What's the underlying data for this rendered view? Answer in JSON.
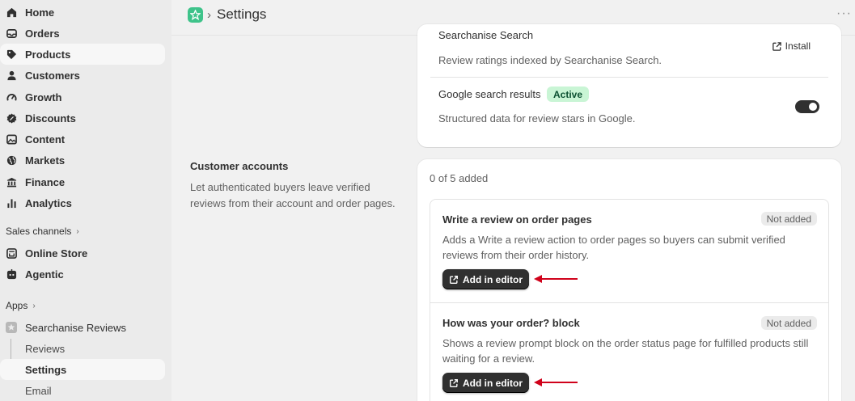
{
  "sidebar": {
    "items": [
      {
        "label": "Home",
        "icon": "home-icon"
      },
      {
        "label": "Orders",
        "icon": "inbox-icon"
      },
      {
        "label": "Products",
        "icon": "tag-icon"
      },
      {
        "label": "Customers",
        "icon": "person-icon"
      },
      {
        "label": "Growth",
        "icon": "gauge-icon"
      },
      {
        "label": "Discounts",
        "icon": "discount-icon"
      },
      {
        "label": "Content",
        "icon": "image-icon"
      },
      {
        "label": "Markets",
        "icon": "globe-icon"
      },
      {
        "label": "Finance",
        "icon": "bank-icon"
      },
      {
        "label": "Analytics",
        "icon": "bar-chart-icon"
      }
    ],
    "sales_channels_heading": "Sales channels",
    "sales_channels": [
      {
        "label": "Online Store",
        "icon": "store-icon"
      },
      {
        "label": "Agentic",
        "icon": "agentic-icon"
      }
    ],
    "apps_heading": "Apps",
    "apps": [
      {
        "label": "Searchanise Reviews",
        "icon": "app-icon"
      }
    ],
    "app_subitems": [
      "Reviews",
      "Settings",
      "Email"
    ]
  },
  "header": {
    "title": "Settings",
    "more": "···"
  },
  "integrations": {
    "searchanise": {
      "title": "Searchanise Search",
      "description": "Review ratings indexed by Searchanise Search.",
      "action": "Install"
    },
    "google": {
      "title": "Google search results",
      "badge": "Active",
      "description": "Structured data for review stars in Google.",
      "toggle_on": true
    }
  },
  "customer_accounts": {
    "title": "Customer accounts",
    "description": "Let authenticated buyers leave verified reviews from their account and order pages.",
    "count": "0 of 5 added",
    "items": [
      {
        "title": "Write a review on order pages",
        "badge": "Not added",
        "description": "Adds a Write a review action to order pages so buyers can submit verified reviews from their order history.",
        "button": "Add in editor"
      },
      {
        "title": "How was your order? block",
        "badge": "Not added",
        "description": "Shows a review prompt block on the order status page for fulfilled products still waiting for a review.",
        "button": "Add in editor"
      }
    ]
  },
  "colors": {
    "accent_dark": "#303030",
    "active_badge_bg": "#c9f5d5",
    "arrow_red": "#d0021b",
    "app_green": "#3ec38a"
  }
}
